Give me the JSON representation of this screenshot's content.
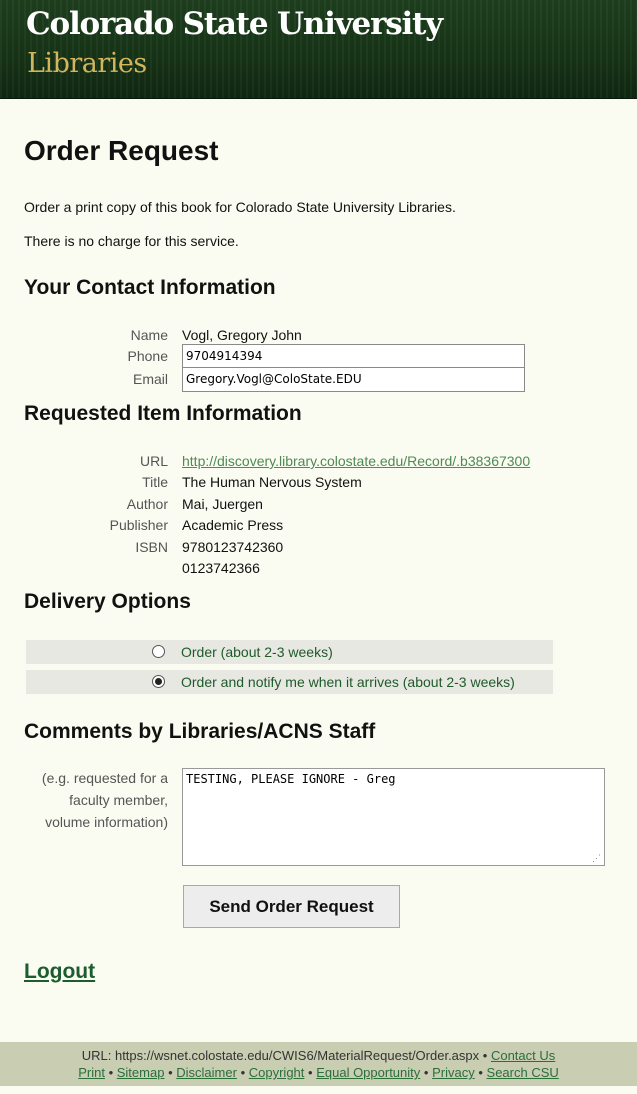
{
  "header": {
    "university": "Colorado State University",
    "unit": "Libraries"
  },
  "page": {
    "title": "Order Request",
    "intro1": "Order a print copy of this book for Colorado State University Libraries.",
    "intro2": "There is no charge for this service."
  },
  "contact": {
    "heading": "Your Contact Information",
    "name_label": "Name",
    "name_value": "Vogl, Gregory John",
    "phone_label": "Phone",
    "phone_value": "9704914394",
    "email_label": "Email",
    "email_value": "Gregory.Vogl@ColoState.EDU"
  },
  "item": {
    "heading": "Requested Item Information",
    "url_label": "URL",
    "url_value": "http://discovery.library.colostate.edu/Record/.b38367300",
    "title_label": "Title",
    "title_value": "The Human Nervous System",
    "author_label": "Author",
    "author_value": "Mai, Juergen",
    "publisher_label": "Publisher",
    "publisher_value": "Academic Press",
    "isbn_label": "ISBN",
    "isbn_values": [
      "9780123742360",
      "0123742366"
    ]
  },
  "delivery": {
    "heading": "Delivery Options",
    "options": [
      {
        "label": "Order (about 2-3 weeks)",
        "selected": false
      },
      {
        "label": "Order and notify me when it arrives (about 2-3 weeks)",
        "selected": true
      }
    ]
  },
  "comments": {
    "heading": "Comments by Libraries/ACNS Staff",
    "hint_lines": [
      "(e.g. requested for a",
      "faculty member,",
      "volume information)"
    ],
    "value": "TESTING, PLEASE IGNORE - Greg"
  },
  "actions": {
    "send_label": "Send Order Request",
    "logout_label": "Logout"
  },
  "footer": {
    "url_prefix": "URL: https://wsnet.colostate.edu/CWIS6/MaterialRequest/Order.aspx",
    "contact": "Contact Us",
    "links": [
      "Print",
      "Sitemap",
      "Disclaimer",
      "Copyright",
      "Equal Opportunity",
      "Privacy",
      "Search CSU"
    ],
    "separator": "•"
  },
  "colors": {
    "header_green": "#163216",
    "libraries_gold": "#d3b55e",
    "link_green": "#4e8a52",
    "footer_bg": "#c9ceb3"
  }
}
